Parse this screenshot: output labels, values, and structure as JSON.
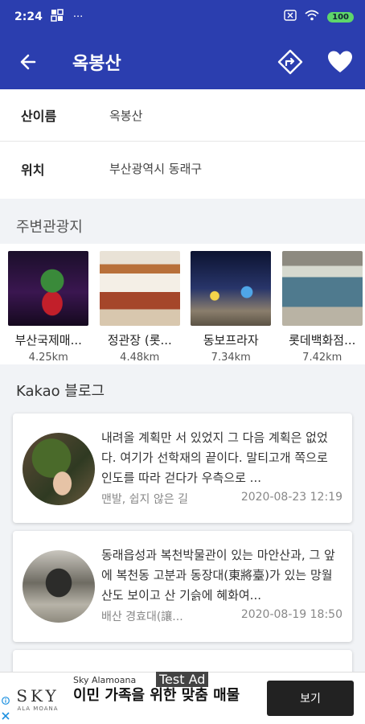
{
  "status_bar": {
    "time": "2:24",
    "dots": "···",
    "battery": "100"
  },
  "toolbar": {
    "title": "옥봉산"
  },
  "info": [
    {
      "label": "산이름",
      "value": "옥봉산"
    },
    {
      "label": "위치",
      "value": "부산광역시 동래구"
    }
  ],
  "nearby": {
    "title": "주변관광지",
    "items": [
      {
        "name": "부산국제매...",
        "distance": "4.25km"
      },
      {
        "name": "정관장 (롯...",
        "distance": "4.48km"
      },
      {
        "name": "동보프라자",
        "distance": "7.34km"
      },
      {
        "name": "롯데백화점...",
        "distance": "7.42km"
      }
    ]
  },
  "blog": {
    "title": "Kakao 블로그",
    "posts": [
      {
        "text": "내려올 계획만 서 있었지 그 다음 계획은 없었다. 여기가 선학재의 끝이다. 말티고개 쪽으로 인도를 따라 걷다가 우측으로 ...",
        "source": "맨발, 쉽지 않은 길",
        "date": "2020-08-23 12:19"
      },
      {
        "text": "동래읍성과 복천박물관이 있는 마안산과, 그 앞에 복천동 고분과 동장대(東將臺)가 있는 망월산도 보이고 산 기슭에 혜화여...",
        "source": "배산 경효대(讓...",
        "date": "2020-08-19 18:50"
      }
    ]
  },
  "ad": {
    "advertiser": "Sky Alamoana",
    "badge": "Test Ad",
    "headline": "이민 가족을 위한 맞춤 매물",
    "cta": "보기",
    "logo_text": "SKY",
    "logo_sub": "ALA MOANA"
  },
  "colors": {
    "appbar": "#2b3eaf",
    "battery": "#5ed66b",
    "cta": "#222222"
  }
}
